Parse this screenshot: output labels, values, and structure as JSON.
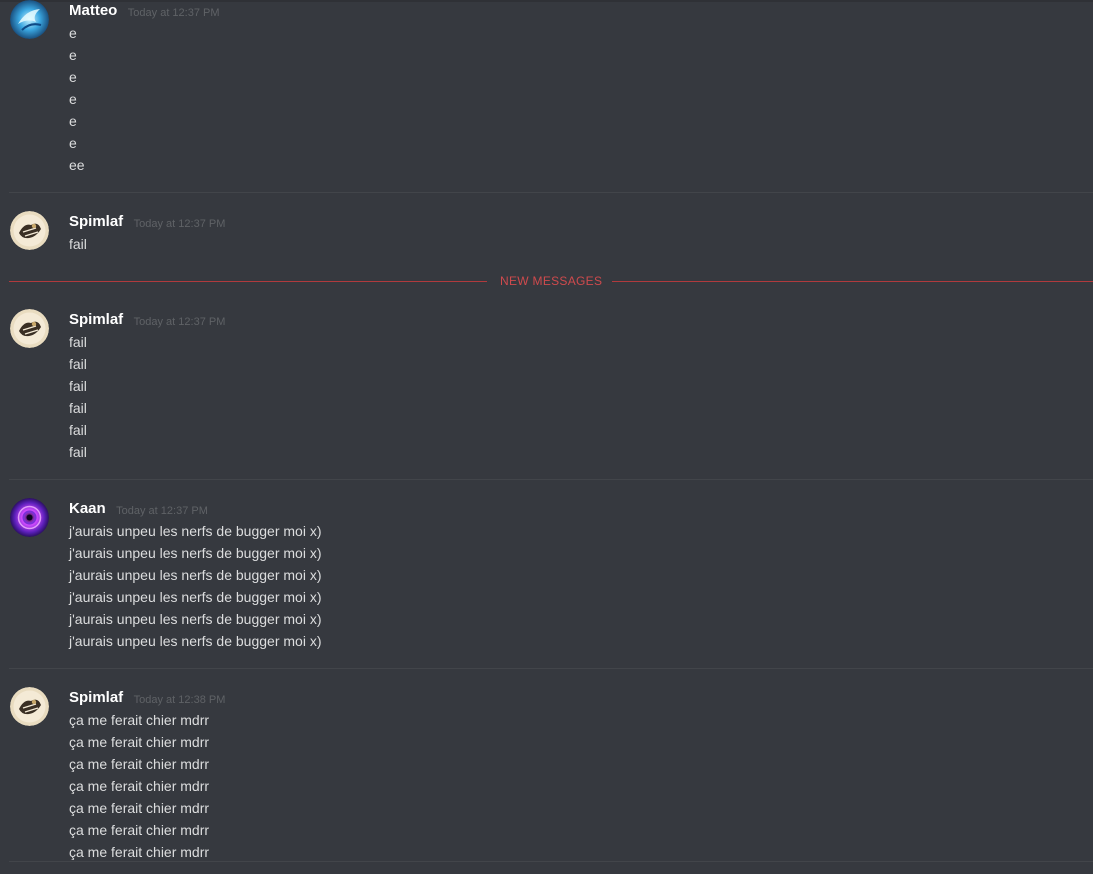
{
  "new_messages_label": "NEW MESSAGES",
  "colors": {
    "background": "#36393f",
    "username": "#ffffff",
    "timestamp": "#5f6266",
    "message_text": "#dcddde",
    "new_messages_accent": "#cf4a4d"
  },
  "groups": [
    {
      "username": "Matteo",
      "timestamp": "Today at 12:37 PM",
      "avatar_icon": "blue-dragon-avatar-icon",
      "lines": [
        "e",
        "e",
        "e",
        "e",
        "e",
        "e",
        "ee"
      ]
    },
    {
      "username": "Spimlaf",
      "timestamp": "Today at 12:37 PM",
      "avatar_icon": "drawing-avatar-icon",
      "lines": [
        "fail"
      ]
    },
    {
      "username": "Spimlaf",
      "timestamp": "Today at 12:37 PM",
      "avatar_icon": "drawing-avatar-icon",
      "lines": [
        "fail",
        "fail",
        "fail",
        "fail",
        "fail",
        "fail"
      ]
    },
    {
      "username": "Kaan",
      "timestamp": "Today at 12:37 PM",
      "avatar_icon": "purple-vortex-avatar-icon",
      "lines": [
        "j'aurais unpeu les nerfs de bugger moi x)",
        "j'aurais unpeu les nerfs de bugger moi x)",
        "j'aurais unpeu les nerfs de bugger moi x)",
        "j'aurais unpeu les nerfs de bugger moi x)",
        "j'aurais unpeu les nerfs de bugger moi x)",
        "j'aurais unpeu les nerfs de bugger moi x)"
      ]
    },
    {
      "username": "Spimlaf",
      "timestamp": "Today at 12:38 PM",
      "avatar_icon": "drawing-avatar-icon",
      "lines": [
        "ça me ferait chier mdrr",
        "ça me ferait chier mdrr",
        "ça me ferait chier mdrr",
        "ça me ferait chier mdrr",
        "ça me ferait chier mdrr",
        "ça me ferait chier mdrr",
        "ça me ferait chier mdrr"
      ]
    }
  ]
}
